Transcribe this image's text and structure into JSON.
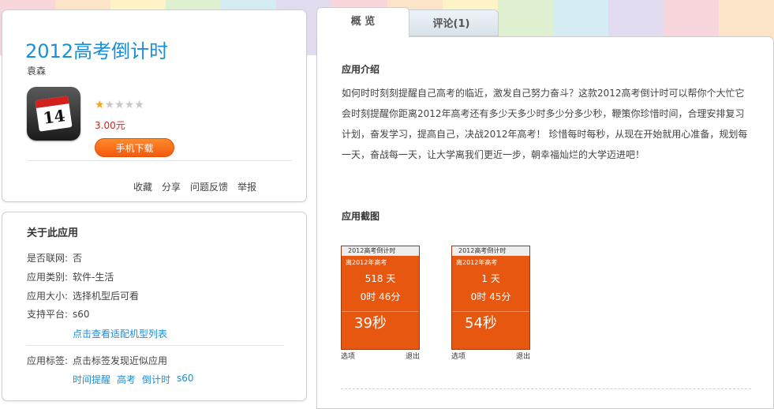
{
  "app": {
    "title": "2012高考倒计时",
    "author": "袁森",
    "rating": 1,
    "rating_max": 5,
    "price": "3.00元",
    "download_label": "手机下载",
    "icon_number": "14",
    "actions": [
      "收藏",
      "分享",
      "问题反馈",
      "举报"
    ]
  },
  "about": {
    "title": "关于此应用",
    "rows": [
      {
        "k": "是否联网:",
        "v": "否"
      },
      {
        "k": "应用类别:",
        "v": "软件-生活"
      },
      {
        "k": "应用大小:",
        "v": "选择机型后可看"
      },
      {
        "k": "支持平台:",
        "v": "s60"
      }
    ],
    "device_link": "点击查看适配机型列表",
    "tags_label": "应用标签:",
    "tags_hint": "点击标签发现近似应用",
    "tags": [
      "时间提醒",
      "高考",
      "倒计时",
      "s60"
    ]
  },
  "tabs": [
    {
      "label": "概 览"
    },
    {
      "label": "评论(1)"
    }
  ],
  "overview": {
    "intro_title": "应用介绍",
    "intro_text": "如何时时刻刻提醒自己高考的临近，激发自己努力奋斗？这款2012高考倒计时可以帮你个大忙它会时刻提醒你距离2012年高考还有多少天多少时多少分多少秒，鞭策你珍惜时间，合理安排复习计划，奋发学习，提高自己，决战2012年高考！ 珍惜每时每秒，从现在开始就用心准备，规划每一天，奋战每一天，让大学离我们更近一步，朝幸福灿烂的大学迈进吧！",
    "screens_title": "应用截图",
    "screens": [
      {
        "bar": "2012高考倒计时",
        "head": "离2012年高考",
        "days": "518 天",
        "hm": "0时  46分",
        "sec": "39秒",
        "left": "选项",
        "right": "退出"
      },
      {
        "bar": "2012高考倒计时",
        "head": "离2012年高考",
        "days": "1 天",
        "hm": "0时  45分",
        "sec": "54秒",
        "left": "选项",
        "right": "退出"
      }
    ]
  },
  "colors": {
    "accent": "#1a8ed6",
    "price": "#d1261a",
    "button": "#f45a0d",
    "stripes": [
      "#f8d7dc",
      "#fbe4c8",
      "#fdf3c6",
      "#dff0d0",
      "#d6ecf5",
      "#e3dcf1",
      "#f8d7dc",
      "#fbe4c8",
      "#fdf3c6",
      "#dff0d0",
      "#d6ecf5",
      "#e3dcf1",
      "#f8d7dc",
      "#fbe4c8"
    ]
  }
}
